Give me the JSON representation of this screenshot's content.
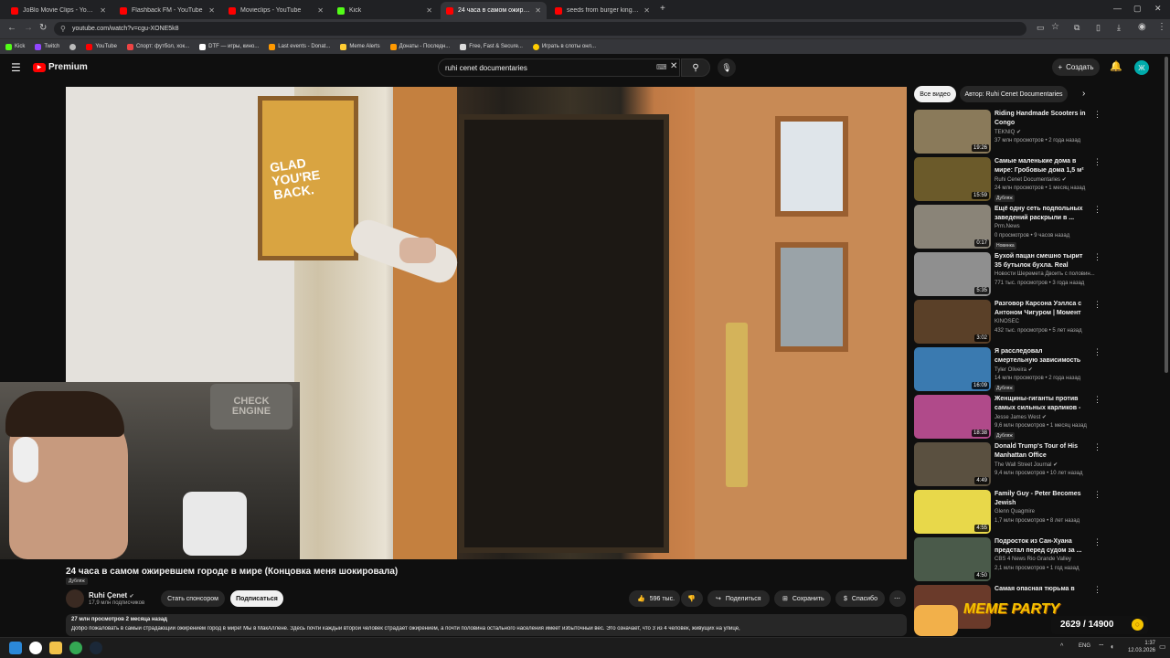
{
  "browser": {
    "tabs": [
      {
        "title": "JoBlo Movie Clips - YouTube",
        "active": false
      },
      {
        "title": "Flashback FM - YouTube",
        "active": false
      },
      {
        "title": "Movieclips - YouTube",
        "active": false
      },
      {
        "title": "Kick",
        "active": false
      },
      {
        "title": "24 часа в самом ожиревш...",
        "active": true
      },
      {
        "title": "seeds from burger king - YouT...",
        "active": false
      }
    ],
    "new_tab": "+",
    "url": "youtube.com/watch?v=cgu-XONE5k8",
    "bookmarks": [
      "Kick",
      "Twitch",
      "",
      "YouTube",
      "Спорт: футбол, хок...",
      "DTF — игры, кино...",
      "Last events - Donat...",
      "Meme Alerts",
      "Донаты - Последн...",
      "Free, Fast & Secure...",
      "Играть в слоты онл..."
    ]
  },
  "youtube": {
    "logo": "Premium",
    "search_value": "ruhi cenet documentaries",
    "create_label": "Создать",
    "avatar_letter": "Ж"
  },
  "video": {
    "title": "24 часа в самом ожиревшем городе в мире (Концовка меня шокировала)",
    "dub_badge": "Дубляж",
    "channel": "Ruhi Çenet",
    "subscribers": "17,9 млн подписчиков",
    "sponsor_label": "Стать спонсором",
    "subscribe_label": "Подписаться",
    "likes": "596 тыс.",
    "share_label": "Поделиться",
    "save_label": "Сохранить",
    "thanks_label": "Спасибо",
    "more": "⋯",
    "views_date": "27 млн просмотров  2 месяца назад",
    "description": "Добро пожаловать в самый страдающий ожирением город в мире! Мы в МакАллене. Здесь почти каждый второй человек страдает ожирением, а почти половина остального населения имеет избыточный вес. Это означает, что 3 из 4 человек, живущих на улице,",
    "scene_sign": "GLAD YOU'RE BACK.",
    "webcam_sign": "CHECK ENGINE"
  },
  "filters": [
    "Все видео",
    "Автор: Ruhi Cenet Documentaries"
  ],
  "recommendations": [
    {
      "title": "Riding Handmade Scooters in Congo",
      "channel": "TEKNIQ",
      "verified": true,
      "meta": "37 млн просмотров • 2 года назад",
      "duration": "19:26",
      "badge": "",
      "color": "#8a7a5a"
    },
    {
      "title": "Самые маленькие дома в мире: Гробовые дома 1,5 м² ...",
      "channel": "Ruhi Cenet Documentaries",
      "verified": true,
      "meta": "24 млн просмотров • 1 месяц назад",
      "duration": "15:59",
      "badge": "Дубляж",
      "color": "#6b5a2a"
    },
    {
      "title": "Ещё одну сеть подпольных заведений раскрыли в ...",
      "channel": "Prm.News",
      "verified": false,
      "meta": "0 просмотров • 9 часов назад",
      "duration": "0:17",
      "badge": "Новинка",
      "color": "#8a8478"
    },
    {
      "title": "Бухой пацан смешно тырит 35 бутылок бухла. Real video",
      "channel": "Новости Шеремета Двоить с половин...",
      "verified": false,
      "meta": "771 тыс. просмотров • 3 года назад",
      "duration": "5:35",
      "badge": "",
      "color": "#8f8f8f"
    },
    {
      "title": "Разговор Карсона Уэллса с Антоном Чигуром | Момент ...",
      "channel": "KINOSEC",
      "verified": false,
      "meta": "432 тыс. просмотров • 5 лет назад",
      "duration": "3:02",
      "badge": "",
      "color": "#5a4028"
    },
    {
      "title": "Я расследовал смертельную зависимость от Coca-Cola в ...",
      "channel": "Tyler Oliveira",
      "verified": true,
      "meta": "14 млн просмотров • 2 года назад",
      "duration": "16:09",
      "badge": "Дубляж",
      "color": "#3a7ab0"
    },
    {
      "title": "Женщины-гиганты против самых сильных карликов - ...",
      "channel": "Jesse James West",
      "verified": true,
      "meta": "9,6 млн просмотров • 1 месяц назад",
      "duration": "18:38",
      "badge": "Дубляж",
      "color": "#b04a8a"
    },
    {
      "title": "Donald Trump's Tour of His Manhattan Office",
      "channel": "The Wall Street Journal",
      "verified": true,
      "meta": "9,4 млн просмотров • 10 лет назад",
      "duration": "4:49",
      "badge": "",
      "color": "#5a5040"
    },
    {
      "title": "Family Guy - Peter Becomes Jewish",
      "channel": "Glenn Quagmire",
      "verified": false,
      "meta": "1,7 млн просмотров • 8 лет назад",
      "duration": "4:55",
      "badge": "",
      "color": "#e8d84a"
    },
    {
      "title": "Подросток из Сан-Хуана предстал перед судом за ...",
      "channel": "CBS 4 News Rio Grande Valley",
      "verified": false,
      "meta": "2,1 млн просмотров • 1 год назад",
      "duration": "4:50",
      "badge": "",
      "color": "#4a5a4a"
    },
    {
      "title": "Самая опасная тюрьма в",
      "channel": "",
      "verified": false,
      "meta": "",
      "duration": "",
      "badge": "",
      "color": "#6a3a2a"
    }
  ],
  "overlay": {
    "label": "MEME PARTY",
    "counter": "2629 / 14900",
    "coin": "○"
  },
  "taskbar": {
    "lang": "ENG",
    "time": "1:37",
    "date": "12.03.2026"
  },
  "colors": {
    "yt_red": "#ff0000",
    "bg": "#0f0f0f",
    "chip": "#272727",
    "subscribe_bg": "#f1f1f1",
    "overlay_gold": "#f5c300"
  }
}
